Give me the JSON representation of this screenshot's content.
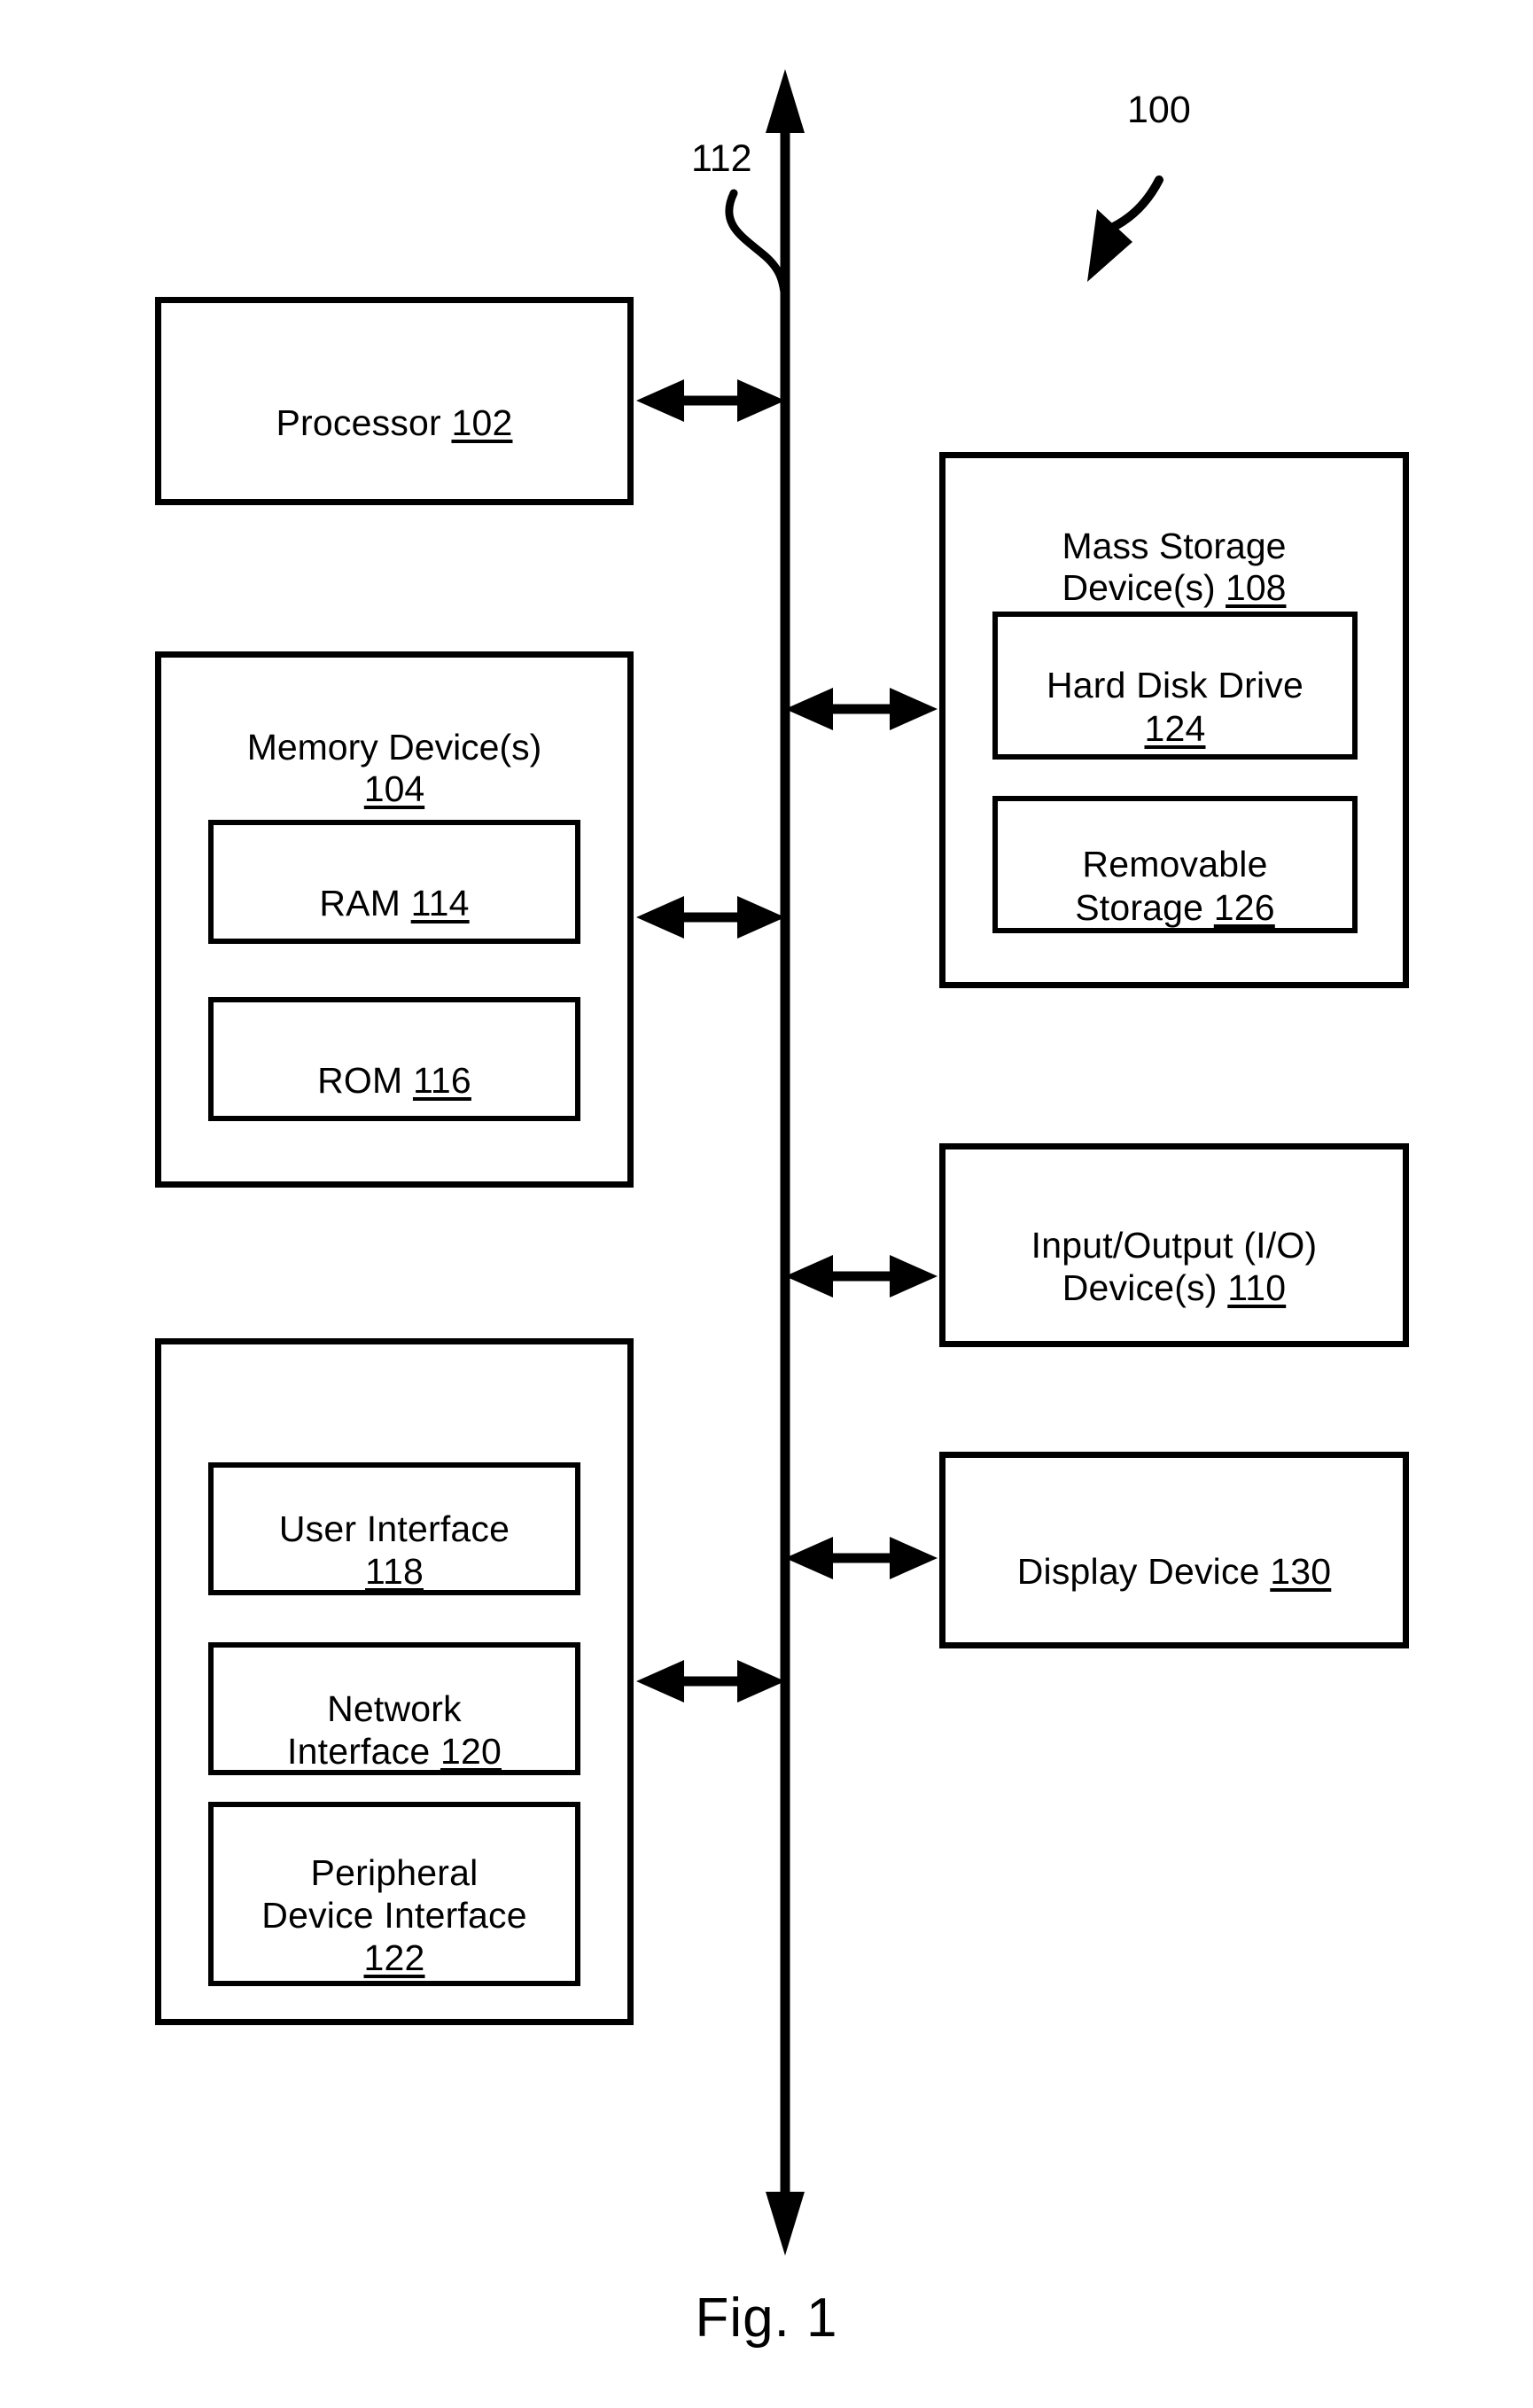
{
  "figure": {
    "caption": "Fig. 1",
    "system_ref": "100",
    "bus_ref": "112"
  },
  "blocks": {
    "processor": {
      "title": "Processor ",
      "ref": "102"
    },
    "memory_container": {
      "title": "Memory Device(s)\n",
      "ref": "104"
    },
    "ram": {
      "title": "RAM ",
      "ref": "114"
    },
    "rom": {
      "title": "ROM ",
      "ref": "116"
    },
    "interfaces_container": {
      "title": "",
      "ref": ""
    },
    "user_interface": {
      "title": "User Interface\n",
      "ref": "118"
    },
    "network_interface": {
      "title": "Network\nInterface ",
      "ref": "120"
    },
    "peripheral_device_interface": {
      "title": "Peripheral\nDevice Interface\n",
      "ref": "122"
    },
    "mass_storage_container": {
      "title": "Mass Storage\nDevice(s) ",
      "ref": "108"
    },
    "hard_disk_drive": {
      "title": "Hard Disk Drive\n",
      "ref": "124"
    },
    "removable_storage": {
      "title": "Removable\nStorage ",
      "ref": "126"
    },
    "io_devices": {
      "title": "Input/Output (I/O)\nDevice(s) ",
      "ref": "110"
    },
    "display_device": {
      "title": "Display Device ",
      "ref": "130"
    }
  },
  "colors": {
    "stroke": "#000000",
    "background": "#ffffff"
  }
}
